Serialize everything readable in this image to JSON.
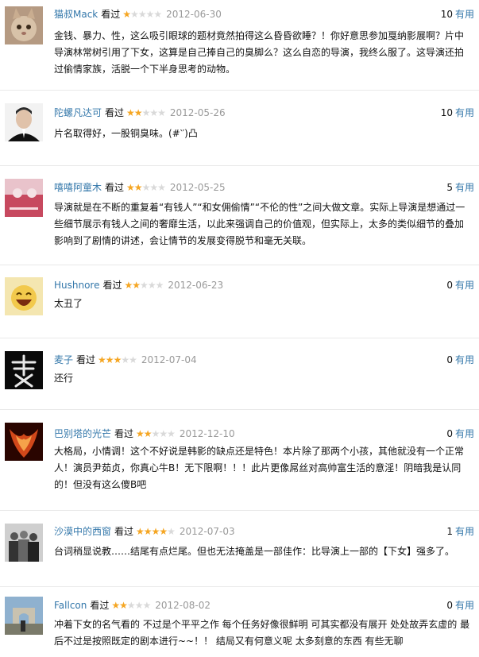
{
  "accent_link": "#3377aa",
  "star_color": "#f5a623",
  "watched_label": "看过",
  "useful_label": "有用",
  "reviews": [
    {
      "user": "猫叔Mack",
      "rating": 1,
      "date": "2012-06-30",
      "useful": "10",
      "text": "金钱、暴力、性，这么吸引眼球的题材竟然拍得这么昏昏欲睡？！你好意思参加戛纳影展啊？片中导演林常树引用了下女，这算是自己捧自己的臭脚么？这么自恋的导演，我终么服了。这导演还拍过偷情家族，活脱一个下半身思考的动物。"
    },
    {
      "user": "陀螺凡达可",
      "rating": 2,
      "date": "2012-05-26",
      "useful": "10",
      "text": "片名取得好，一股铜臭味。(#‵′)凸"
    },
    {
      "user": "嘻嘻阿童木",
      "rating": 2,
      "date": "2012-05-25",
      "useful": "5",
      "text": "导演就是在不断的重复着“有钱人”“和女佣偷情”“不伦的性”之间大做文章。实际上导演是想通过一些细节展示有钱人之间的奢靡生活，以此来强调自己的价值观，但实际上，太多的类似细节的叠加影响到了剧情的讲述，会让情节的发展变得脱节和毫无关联。"
    },
    {
      "user": "Hushnore",
      "rating": 2,
      "date": "2012-06-23",
      "useful": "0",
      "text": "太丑了"
    },
    {
      "user": "麦子",
      "rating": 3,
      "date": "2012-07-04",
      "useful": "0",
      "text": "还行"
    },
    {
      "user": "巴别塔的光芒",
      "rating": 2,
      "date": "2012-12-10",
      "useful": "0",
      "text": "大格局，小情调！这个不好说是韩影的缺点还是特色！本片除了那两个小孩，其他就没有一个正常人！演员尹茹贞，你真心牛B！无下限啊！！！此片更像屌丝对高帅富生活的意淫！阴暗我是认同的！但没有这么傻B吧"
    },
    {
      "user": "沙漠中的西窗",
      "rating": 4,
      "date": "2012-07-03",
      "useful": "1",
      "text": "台词稍显说教……结尾有点烂尾。但也无法掩盖是一部佳作：比导演上一部的【下女】强多了。"
    },
    {
      "user": "Fallcon",
      "rating": 2,
      "date": "2012-08-02",
      "useful": "0",
      "text": "冲着下女的名气看的 不过是个平平之作 每个任务好像很鲜明 可其实都没有展开 处处故弄玄虚的 最后不过是按照既定的剧本进行~~！！ 结局又有何意义呢 太多刻意的东西 有些无聊"
    }
  ]
}
